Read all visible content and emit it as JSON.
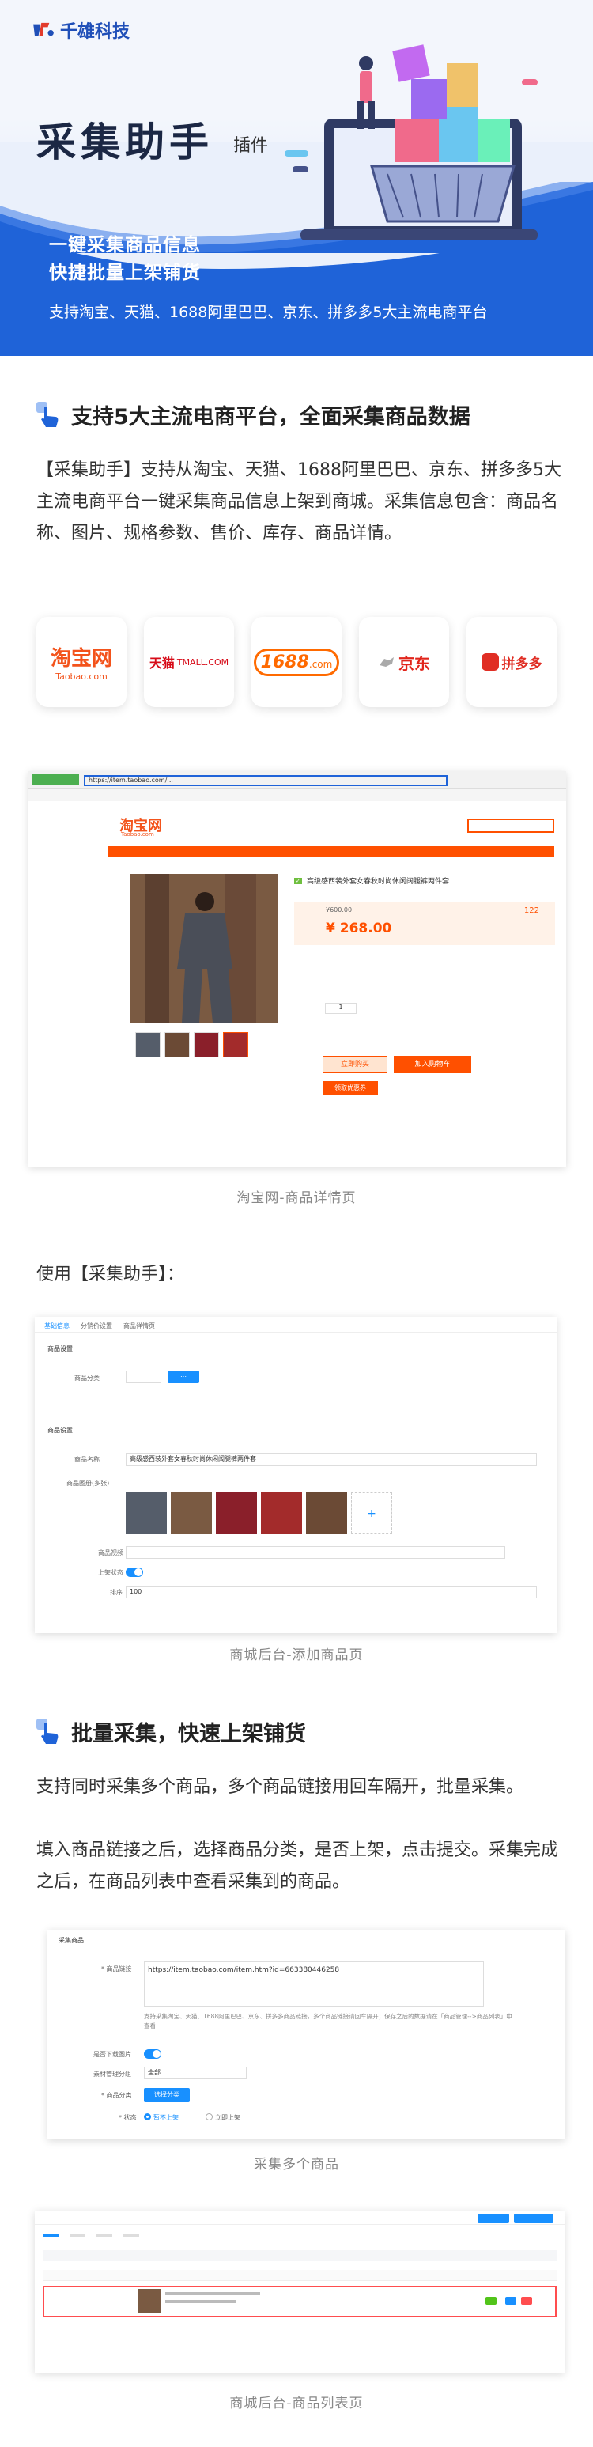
{
  "brand": {
    "name": "千雄科技"
  },
  "hero": {
    "title": "采集助手",
    "subtitle": "插件",
    "line1": "一键采集商品信息",
    "line2": "快捷批量上架铺货",
    "platforms": "支持淘宝、天猫、1688阿里巴巴、京东、拼多多5大主流电商平台"
  },
  "section1": {
    "heading": "支持5大主流电商平台，全面采集商品数据",
    "para": "【采集助手】支持从淘宝、天猫、1688阿里巴巴、京东、拼多多5大主流电商平台一键采集商品信息上架到商城。采集信息包含：商品名称、图片、规格参数、售价、库存、商品详情。",
    "logos": [
      {
        "main": "淘宝网",
        "sub": "Taobao.com"
      },
      {
        "main": "天猫",
        "sub": "TMALL.COM"
      },
      {
        "main": "1688",
        "sub": ".com"
      },
      {
        "main": "京东",
        "sub": ""
      },
      {
        "main": "拼多多",
        "sub": ""
      }
    ]
  },
  "taobao": {
    "url": "https://item.taobao.com/...",
    "logo": "淘宝网",
    "logo_sub": "Taobao.com",
    "product_title": "高级感西装外套女春秋时尚休闲阔腿裤两件套",
    "price_orig": "¥600.00",
    "price": "¥ 268.00",
    "sales": "122",
    "qty": "1",
    "buy": "立即购买",
    "cart": "加入购物车",
    "coupon": "领取优惠券",
    "caption": "淘宝网-商品详情页"
  },
  "use_label": "使用【采集助手】：",
  "admin_add": {
    "tabs": [
      "基础信息",
      "分销价设置",
      "商品详情页"
    ],
    "labels": [
      "商品分类",
      "商品名称",
      "商品图册(多张)",
      "商品视频",
      "上架状态",
      "排序"
    ],
    "section_label": "商品设置",
    "section2": "商品设置",
    "name_value": "高级感西装外套女春秋时尚休闲阔腿裤两件套",
    "sort_value": "100",
    "caption": "商城后台-添加商品页"
  },
  "section2": {
    "heading": "批量采集，快速上架铺货",
    "para1": "支持同时采集多个商品，多个商品链接用回车隔开，批量采集。",
    "para2": "填入商品链接之后，选择商品分类，是否上架，点击提交。采集完成之后，在商品列表中查看采集到的商品。"
  },
  "collect": {
    "title": "采集商品",
    "link_label": "* 商品链接",
    "link_value": "https://item.taobao.com/item.htm?id=663380446258",
    "hint": "支持采集淘宝、天猫、1688阿里巴巴、京东、拼多多商品链接，多个商品链接请回车隔开；保存之后的数据请在「商品管理-->商品列表」中查看",
    "download_label": "是否下载图片",
    "group_label": "素材管理分组",
    "group_value": "全部",
    "cat_label": "* 商品分类",
    "cat_button": "选择分类",
    "status_label": "* 状态",
    "opt1": "暂不上架",
    "opt2": "立即上架",
    "caption": "采集多个商品"
  },
  "list": {
    "caption": "商城后台-商品列表页"
  }
}
